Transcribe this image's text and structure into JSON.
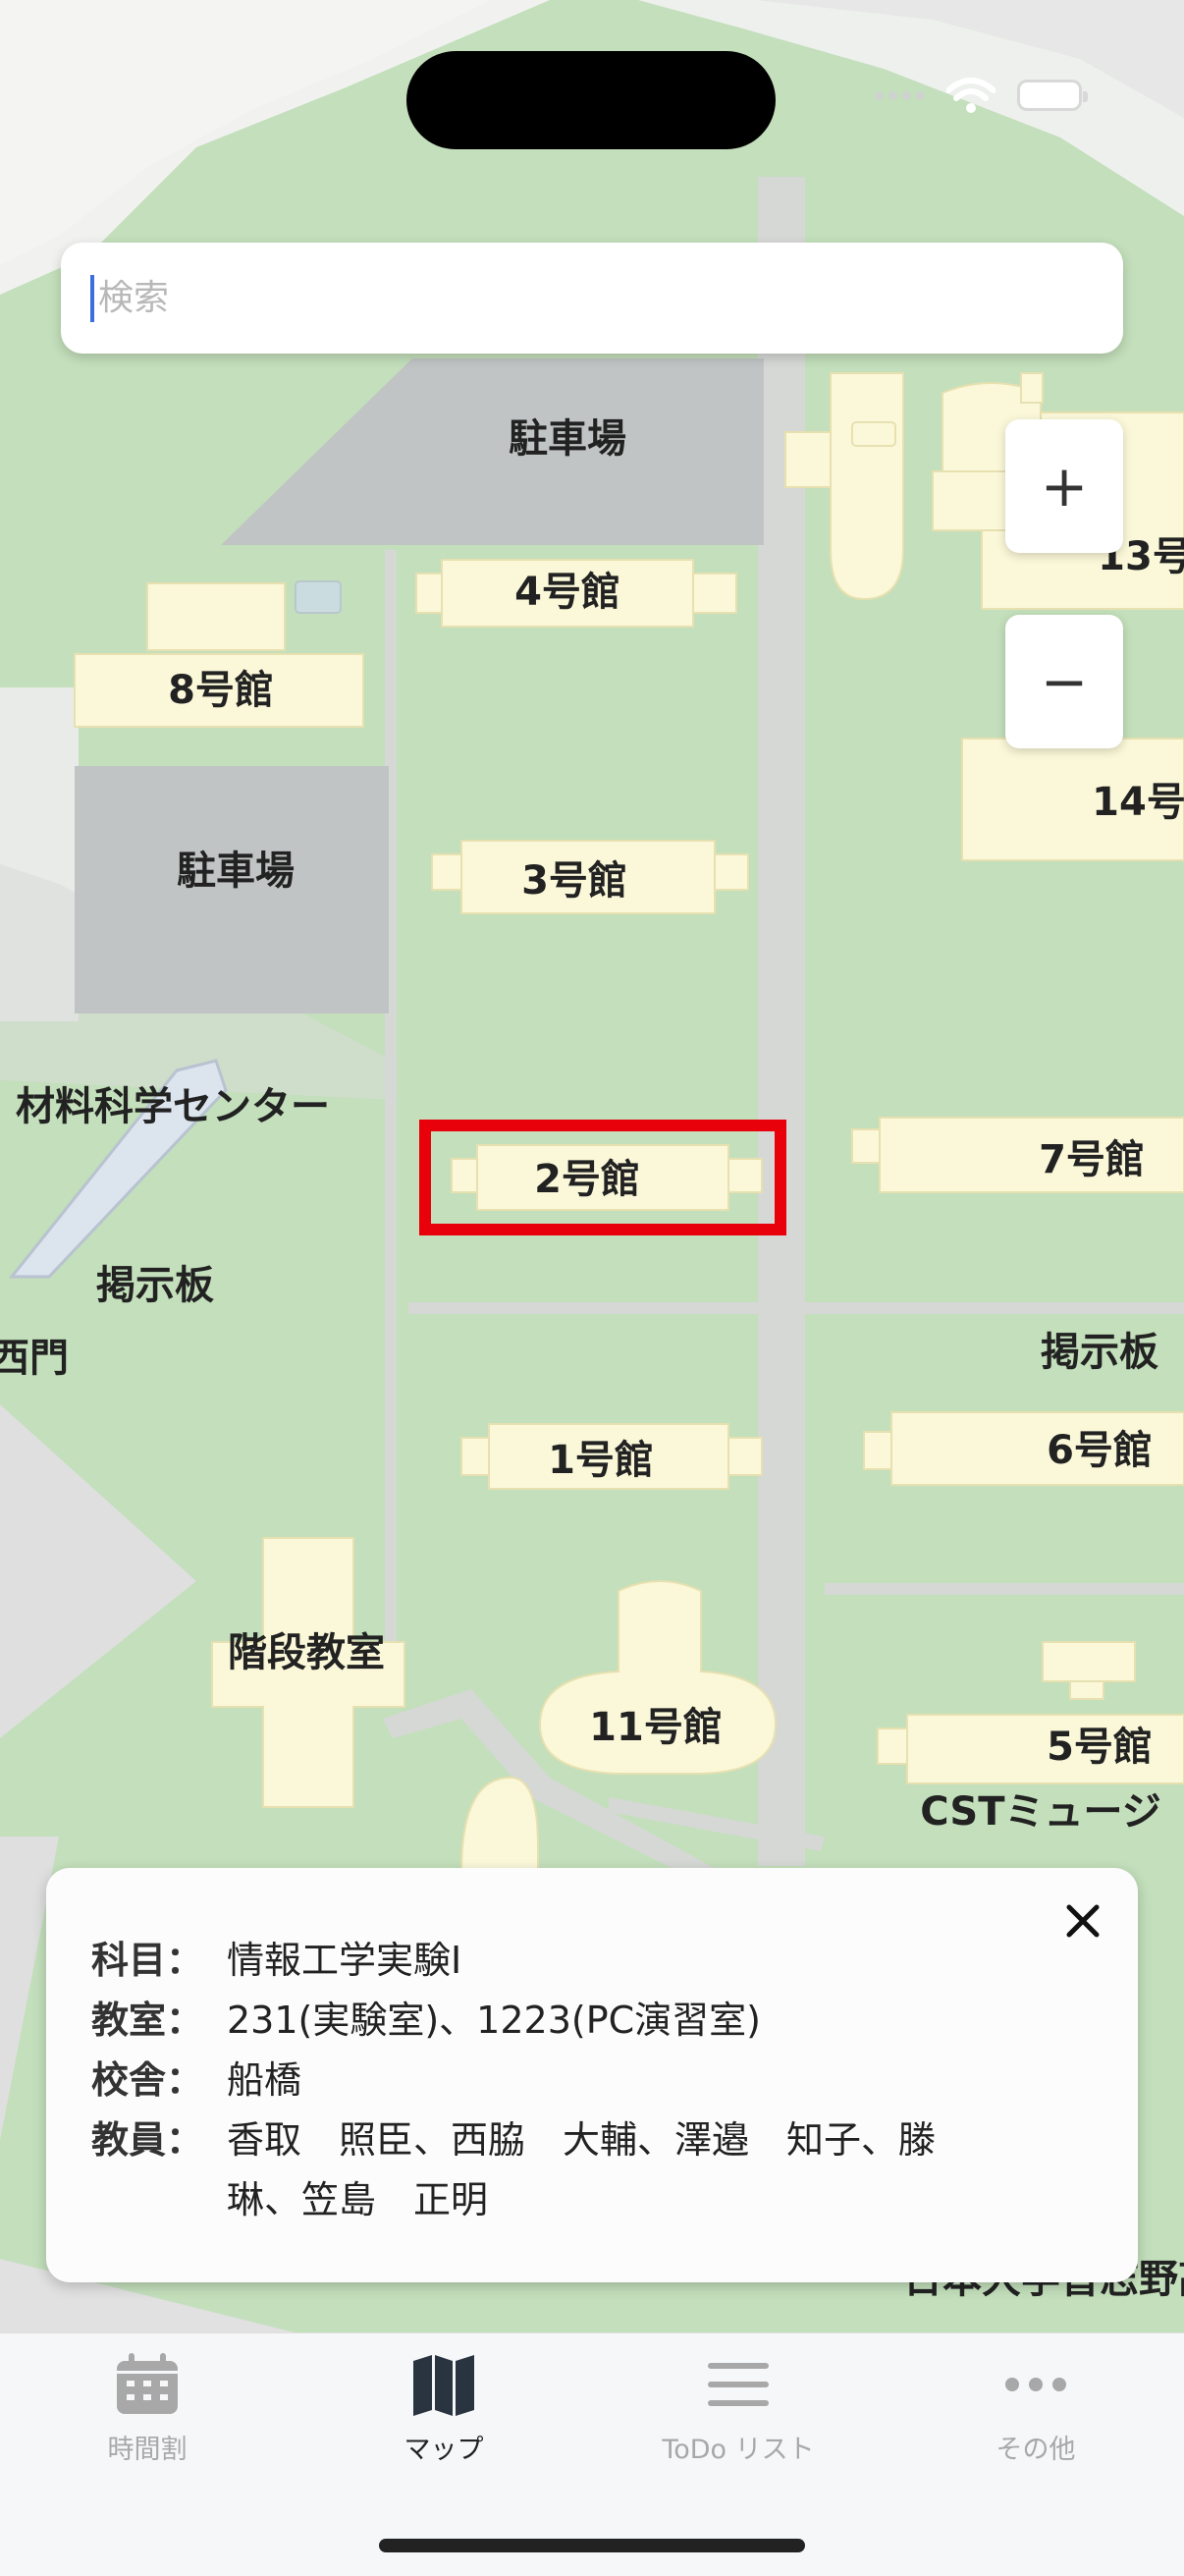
{
  "search": {
    "placeholder": "検索"
  },
  "zoom": {
    "in_label": "+",
    "out_label": "−"
  },
  "map": {
    "labels": {
      "parking_top": "駐車場",
      "parking_left": "駐車場",
      "bldg4": "4号館",
      "bldg8": "8号館",
      "bldg3": "3号館",
      "bldg2": "2号館",
      "bldg1": "1号館",
      "bldg7": "7号館",
      "bldg6": "6号館",
      "bldg5": "5号館",
      "bldg11": "11号館",
      "bldg13": "13号",
      "bldg14": "14号",
      "materials": "材料科学センター",
      "board_left": "掲示板",
      "board_right": "掲示板",
      "west_gate": "西門",
      "stair_room": "階段教室",
      "cst_museum": "CSTミュージ",
      "bottom_right": "日本大学習志野高"
    },
    "highlight": {
      "color": "#e8000b"
    }
  },
  "info_card": {
    "rows": [
      {
        "label": "科目：",
        "value": "情報工学実験Ⅰ"
      },
      {
        "label": "教室：",
        "value": "231(実験室)、1223(PC演習室)"
      },
      {
        "label": "校舎：",
        "value": "船橋"
      },
      {
        "label": "教員：",
        "value": "香取　照臣、西脇　大輔、澤邉　知子、滕　琳、笠島　正明"
      }
    ]
  },
  "tabs": [
    {
      "label": "時間割",
      "icon": "calendar-icon",
      "active": false
    },
    {
      "label": "マップ",
      "icon": "map-icon",
      "active": true
    },
    {
      "label": "ToDo リスト",
      "icon": "list-icon",
      "active": false
    },
    {
      "label": "その他",
      "icon": "ellipsis-icon",
      "active": false
    }
  ],
  "colors": {
    "grass": "#c3dfbb",
    "building": "#fbf8d9",
    "parking": "#c1c4c4",
    "road": "#dddddd",
    "active_tab": "#222222",
    "inactive_tab": "#a8a8a8"
  }
}
